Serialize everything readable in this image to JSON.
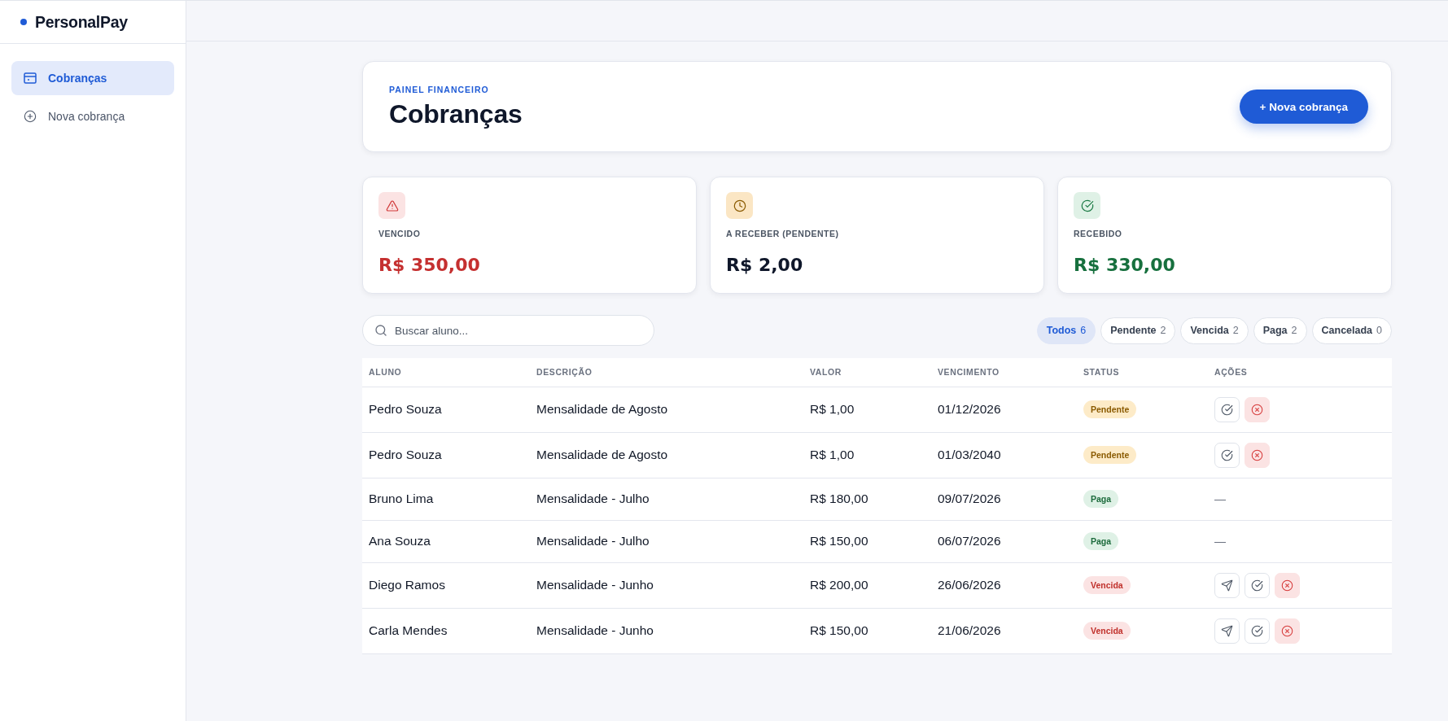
{
  "sidebar": {
    "brand": "PersonalPay",
    "items": [
      {
        "kind": "charges",
        "label": "Cobranças",
        "selected": true
      },
      {
        "kind": "new",
        "label": "Nova cobrança",
        "selected": false
      }
    ]
  },
  "header": {
    "eyebrow": "PAINEL FINANCEIRO",
    "title": "Cobranças",
    "action": "+ Nova cobrança"
  },
  "stats": [
    {
      "kind": "overdue",
      "label": "VENCIDO",
      "value": "R$ 350,00"
    },
    {
      "kind": "pending",
      "label": "A RECEBER (PENDENTE)",
      "value": "R$ 2,00"
    },
    {
      "kind": "received",
      "label": "RECEBIDO",
      "value": "R$ 330,00"
    }
  ],
  "search": {
    "placeholder": "Buscar aluno..."
  },
  "filters": [
    {
      "label": "Todos",
      "count": "6",
      "selected": true
    },
    {
      "label": "Pendente",
      "count": "2",
      "selected": false
    },
    {
      "label": "Vencida",
      "count": "2",
      "selected": false
    },
    {
      "label": "Paga",
      "count": "2",
      "selected": false
    },
    {
      "label": "Cancelada",
      "count": "0",
      "selected": false
    }
  ],
  "table": {
    "columns": [
      "ALUNO",
      "DESCRIÇÃO",
      "VALOR",
      "VENCIMENTO",
      "STATUS",
      "AÇÕES"
    ],
    "rows": [
      {
        "student": "Pedro Souza",
        "description": "Mensalidade de Agosto",
        "amount": "R$ 1,00",
        "due_date": "01/12/2026",
        "status": {
          "kind": "pending",
          "label": "Pendente"
        },
        "actions": [
          {
            "kind": "confirm"
          },
          {
            "kind": "cancel"
          }
        ]
      },
      {
        "student": "Pedro Souza",
        "description": "Mensalidade de Agosto",
        "amount": "R$ 1,00",
        "due_date": "01/03/2040",
        "status": {
          "kind": "pending",
          "label": "Pendente"
        },
        "actions": [
          {
            "kind": "confirm"
          },
          {
            "kind": "cancel"
          }
        ]
      },
      {
        "student": "Bruno Lima",
        "description": "Mensalidade - Julho",
        "amount": "R$ 180,00",
        "due_date": "09/07/2026",
        "status": {
          "kind": "paid",
          "label": "Paga"
        },
        "actions_text": "—"
      },
      {
        "student": "Ana Souza",
        "description": "Mensalidade - Julho",
        "amount": "R$ 150,00",
        "due_date": "06/07/2026",
        "status": {
          "kind": "paid",
          "label": "Paga"
        },
        "actions_text": "—"
      },
      {
        "student": "Diego Ramos",
        "description": "Mensalidade - Junho",
        "amount": "R$ 200,00",
        "due_date": "26/06/2026",
        "status": {
          "kind": "overdue",
          "label": "Vencida"
        },
        "actions": [
          {
            "kind": "send"
          },
          {
            "kind": "confirm"
          },
          {
            "kind": "cancel"
          }
        ]
      },
      {
        "student": "Carla Mendes",
        "description": "Mensalidade - Junho",
        "amount": "R$ 150,00",
        "due_date": "21/06/2026",
        "status": {
          "kind": "overdue",
          "label": "Vencida"
        },
        "actions": [
          {
            "kind": "send"
          },
          {
            "kind": "confirm"
          },
          {
            "kind": "cancel"
          }
        ]
      }
    ]
  }
}
